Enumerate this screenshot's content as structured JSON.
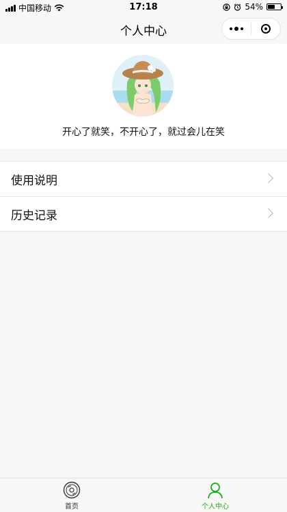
{
  "status_bar": {
    "carrier": "中国移动",
    "time": "17:18",
    "battery_text": "54%",
    "battery_level": 0.54
  },
  "nav": {
    "title": "个人中心"
  },
  "profile": {
    "motto": "开心了就笑，不开心了，就过会儿在笑"
  },
  "menu": {
    "items": [
      {
        "label": "使用说明"
      },
      {
        "label": "历史记录"
      }
    ]
  },
  "tab_bar": {
    "tabs": [
      {
        "label": "首页",
        "icon": "disc-icon",
        "active": false
      },
      {
        "label": "个人中心",
        "icon": "person-icon",
        "active": true
      }
    ]
  },
  "colors": {
    "accent": "#1aad19",
    "background": "#f6f6f6"
  }
}
